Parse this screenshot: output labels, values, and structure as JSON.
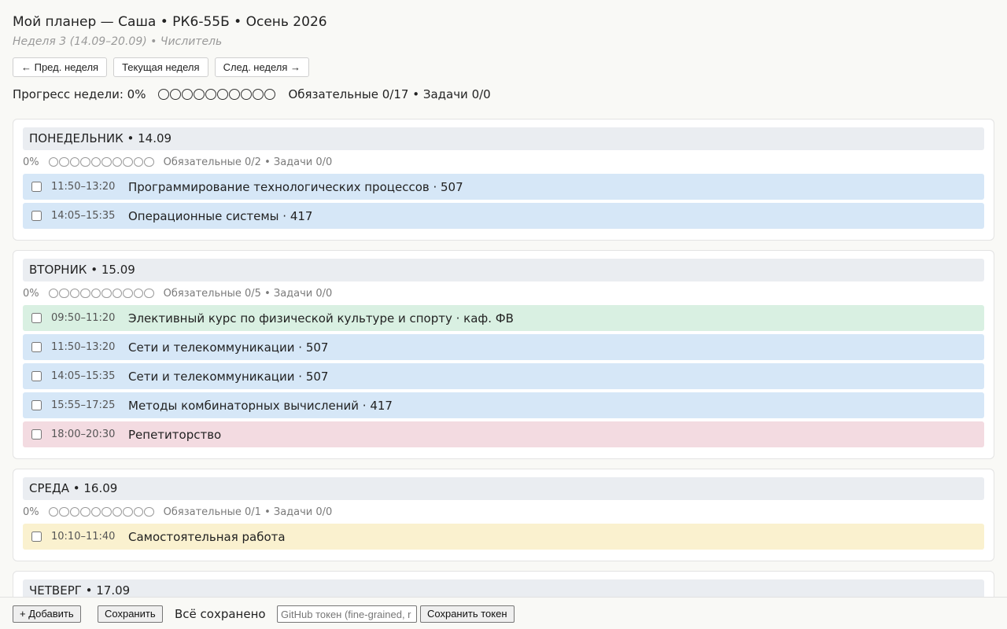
{
  "header": {
    "title": "Мой планер — Саша • РК6-55Б • Осень 2026",
    "subtitle": "Неделя 3 (14.09–20.09) • Числитель"
  },
  "nav": {
    "prev": "← Пред. неделя",
    "current": "Текущая неделя",
    "next": "След. неделя →"
  },
  "week_progress": {
    "label": "Прогресс недели: 0%",
    "percent": 0,
    "dots_total": 10,
    "dots_filled": 0,
    "counts": "Обязательные 0/17 • Задачи 0/0"
  },
  "colors": {
    "lecture": "#d6e7f7",
    "sport": "#d9f0e2",
    "tutoring": "#f3dbe1",
    "self_study": "#faf1cf",
    "day_header": "#eaedf1"
  },
  "days": [
    {
      "title": "ПОНЕДЕЛЬНИК • 14.09",
      "percent_label": "0%",
      "percent": 0,
      "counts": "Обязательные 0/2 • Задачи 0/0",
      "slots": [
        {
          "time": "11:50–13:20",
          "name": "Программирование технологических процессов · 507",
          "kind": "lecture"
        },
        {
          "time": "14:05–15:35",
          "name": "Операционные системы · 417",
          "kind": "lecture"
        }
      ]
    },
    {
      "title": "ВТОРНИК • 15.09",
      "percent_label": "0%",
      "percent": 0,
      "counts": "Обязательные 0/5 • Задачи 0/0",
      "slots": [
        {
          "time": "09:50–11:20",
          "name": "Элективный курс по физической культуре и спорту · каф. ФВ",
          "kind": "sport"
        },
        {
          "time": "11:50–13:20",
          "name": "Сети и телекоммуникации · 507",
          "kind": "lecture"
        },
        {
          "time": "14:05–15:35",
          "name": "Сети и телекоммуникации · 507",
          "kind": "lecture"
        },
        {
          "time": "15:55–17:25",
          "name": "Методы комбинаторных вычислений · 417",
          "kind": "lecture"
        },
        {
          "time": "18:00–20:30",
          "name": "Репетиторство",
          "kind": "tutoring"
        }
      ]
    },
    {
      "title": "СРЕДА • 16.09",
      "percent_label": "0%",
      "percent": 0,
      "counts": "Обязательные 0/1 • Задачи 0/0",
      "slots": [
        {
          "time": "10:10–11:40",
          "name": "Самостоятельная работа",
          "kind": "self_study"
        }
      ]
    },
    {
      "title": "ЧЕТВЕРГ • 17.09",
      "percent_label": "",
      "percent": 0,
      "counts": "",
      "slots": []
    }
  ],
  "bottom_bar": {
    "add": "+ Добавить",
    "save": "Сохранить",
    "status": "Всё сохранено",
    "token_placeholder": "GitHub токен (fine-grained, r",
    "save_token": "Сохранить токен"
  }
}
